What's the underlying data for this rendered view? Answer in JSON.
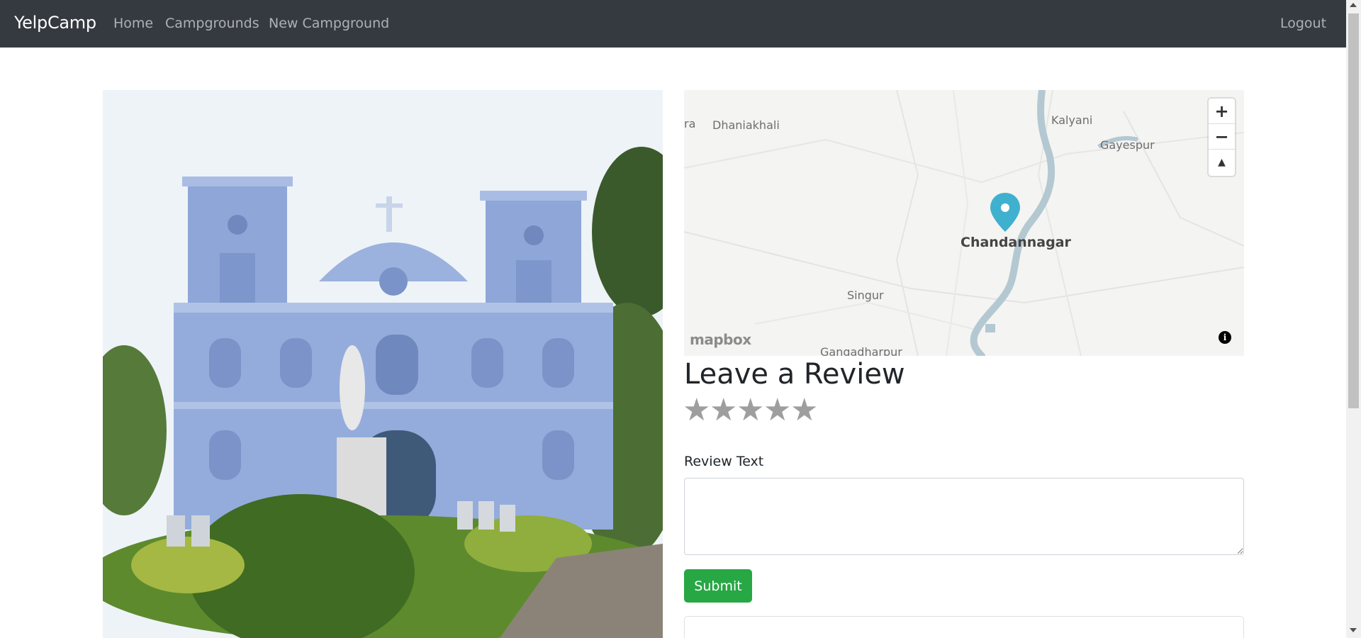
{
  "navbar": {
    "brand": "YelpCamp",
    "links": {
      "home": "Home",
      "campgrounds": "Campgrounds",
      "new_campground": "New Campground",
      "logout": "Logout"
    }
  },
  "map": {
    "labels": {
      "ra": "ra",
      "dhaniakhali": "Dhaniakhali",
      "kalyani": "Kalyani",
      "gayespur": "Gayespur",
      "chandannagar": "Chandannagar",
      "singur": "Singur",
      "gangadharpur": "Gangadharpur"
    },
    "controls": {
      "zoom_in": "+",
      "zoom_out": "−",
      "compass": "▲"
    },
    "attribution": "mapbox",
    "info": "i",
    "colors": {
      "marker": "#3fb1ce",
      "river": "#b4c8d2",
      "land": "#f4f4f3"
    }
  },
  "review": {
    "title": "Leave a Review",
    "rating": 0,
    "star_glyph": "★",
    "label": "Review Text",
    "text_value": "",
    "submit_label": "Submit"
  },
  "colors": {
    "navbar_bg": "#343a40",
    "submit_bg": "#28a745",
    "star": "#9e9e9e"
  }
}
